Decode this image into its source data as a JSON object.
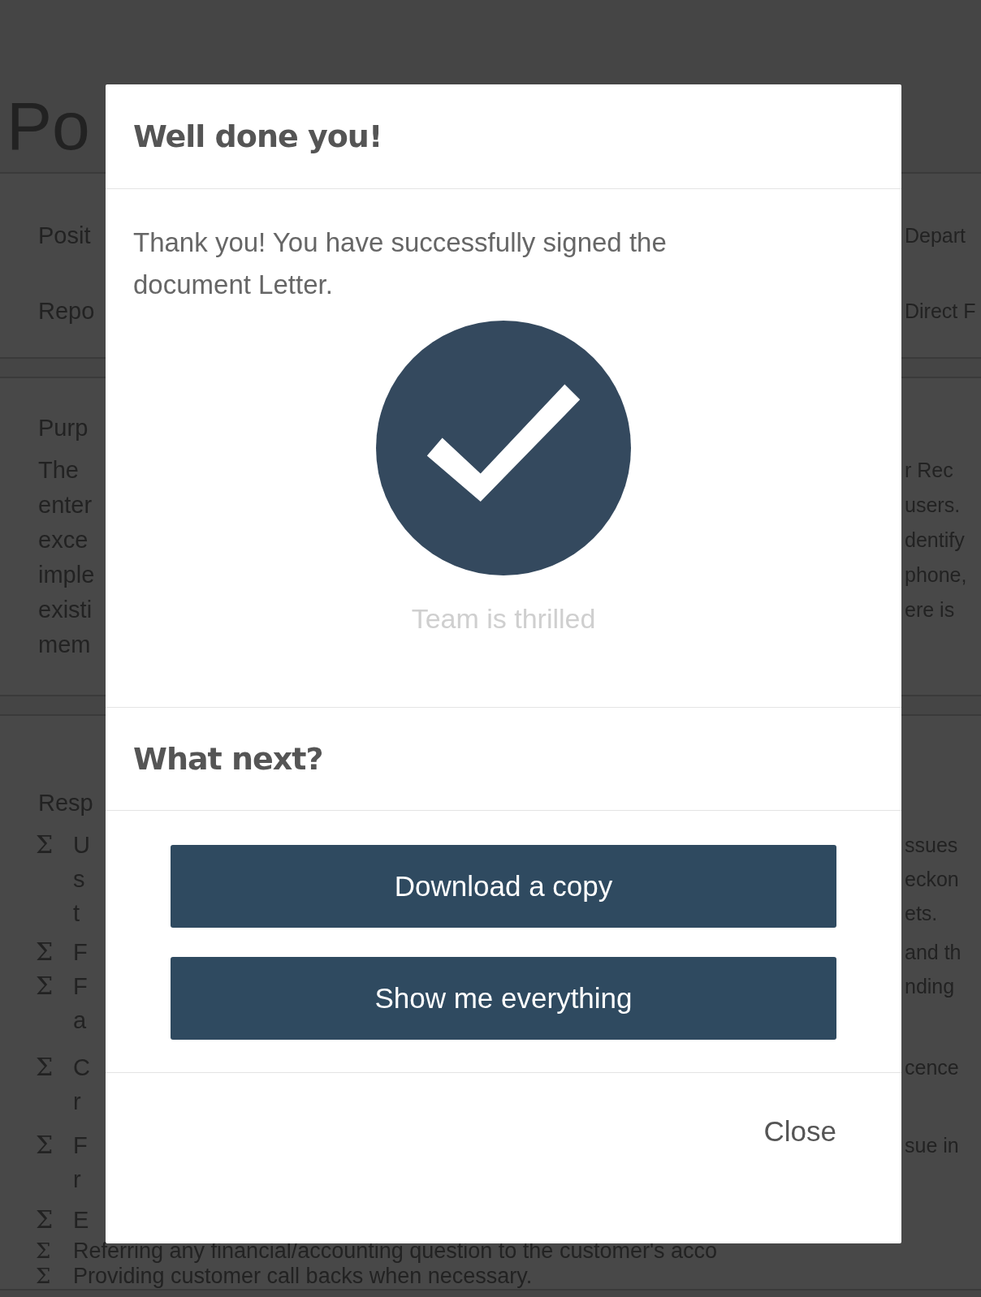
{
  "document": {
    "title": "Po",
    "fields": [
      {
        "left": "Posit",
        "right": "Depart"
      },
      {
        "left": "Repo",
        "right": "Direct F"
      }
    ],
    "purpose": {
      "heading": "Purp",
      "lines": [
        {
          "left": "The",
          "right": "r Rec"
        },
        {
          "left": "enter",
          "right": "users."
        },
        {
          "left": "exce",
          "right": "dentify"
        },
        {
          "left": "imple",
          "right": "phone,"
        },
        {
          "left": "existi",
          "right": "ere is"
        },
        {
          "left": "mem"
        }
      ]
    },
    "responsibilities": {
      "heading": "Resp",
      "items": [
        {
          "bullet": "Σ",
          "lines": [
            {
              "left": "U",
              "right": "ssues"
            },
            {
              "left": "s",
              "right": "eckon"
            },
            {
              "left": "t",
              "right": "ets."
            }
          ]
        },
        {
          "bullet": "Σ",
          "lines": [
            {
              "left": "F",
              "right": "and th"
            }
          ]
        },
        {
          "bullet": "Σ",
          "lines": [
            {
              "left": "F",
              "right": "nding"
            },
            {
              "left": "a"
            }
          ]
        },
        {
          "bullet": "Σ",
          "lines": [
            {
              "left": "C",
              "right": "cence"
            },
            {
              "left": "r"
            }
          ]
        },
        {
          "bullet": "Σ",
          "lines": [
            {
              "left": "F",
              "right": "sue in"
            },
            {
              "left": "r"
            }
          ]
        },
        {
          "bullet": "Σ",
          "lines": [
            {
              "left": "E"
            }
          ]
        },
        {
          "bullet": "Σ",
          "lines": [
            {
              "left": "Referring any financial/accounting question to the customer's acco"
            }
          ]
        },
        {
          "bullet": "Σ",
          "lines": [
            {
              "left": "Providing customer call backs when necessary."
            }
          ]
        }
      ]
    }
  },
  "dialog": {
    "title": "Well done you!",
    "message": "Thank you! You have successfully signed the document Letter.",
    "caption": "Team is thrilled",
    "next_heading": "What next?",
    "actions": [
      "Download a copy",
      "Show me everything"
    ],
    "close": "Close"
  }
}
